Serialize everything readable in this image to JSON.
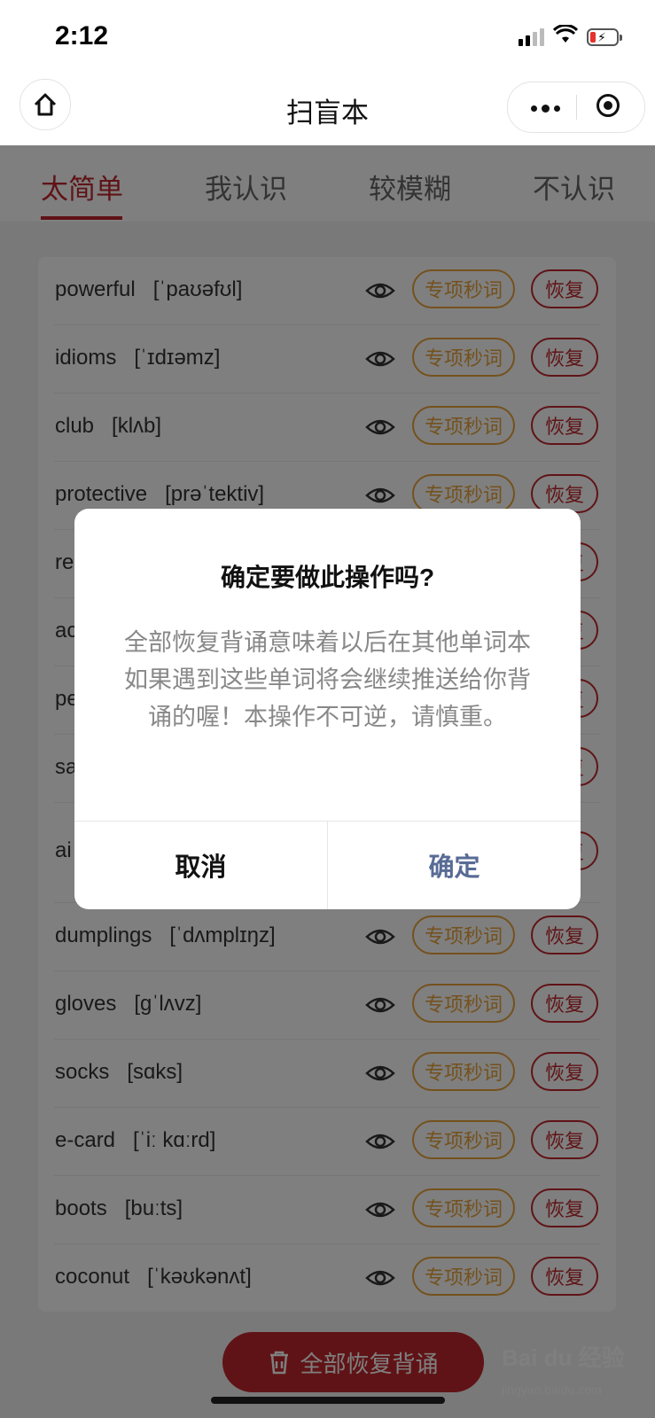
{
  "status_bar": {
    "time": "2:12"
  },
  "nav": {
    "title": "扫盲本"
  },
  "tabs": [
    {
      "label": "太简单",
      "active": true
    },
    {
      "label": "我认识",
      "active": false
    },
    {
      "label": "较模糊",
      "active": false
    },
    {
      "label": "不认识",
      "active": false
    }
  ],
  "words": [
    {
      "word": "powerful",
      "phonetic": "[ˈpaʊəfʊl]"
    },
    {
      "word": "idioms",
      "phonetic": "[ˈɪdɪəmz]"
    },
    {
      "word": "club",
      "phonetic": "[klʌb]"
    },
    {
      "word": "protective",
      "phonetic": "[prəˈtektiv]"
    },
    {
      "word": "re",
      "phonetic": ""
    },
    {
      "word": "ac",
      "phonetic": ""
    },
    {
      "word": "pe",
      "phonetic": ""
    },
    {
      "word": "sa",
      "phonetic": ""
    },
    {
      "word": "ai",
      "phonetic": ""
    },
    {
      "word": "dumplings",
      "phonetic": "[ˈdʌmplɪŋz]"
    },
    {
      "word": "gloves",
      "phonetic": "[gˈlʌvz]"
    },
    {
      "word": "socks",
      "phonetic": "[sɑks]"
    },
    {
      "word": "e-card",
      "phonetic": "[ˈiː kɑːrd]"
    },
    {
      "word": "boots",
      "phonetic": "[buːts]"
    },
    {
      "word": "coconut",
      "phonetic": "[ˈkəʊkənʌt]"
    }
  ],
  "row_buttons": {
    "special": "专项秒词",
    "restore": "恢复"
  },
  "restore_all": "全部恢复背诵",
  "dialog": {
    "title": "确定要做此操作吗?",
    "body": "全部恢复背诵意味着以后在其他单词本如果遇到这些单词将会继续推送给你背诵的喔！本操作不可逆，请慎重。",
    "cancel": "取消",
    "confirm": "确定"
  },
  "watermark": {
    "brand": "Bai du 经验",
    "url": "jingyan.baidu.com"
  },
  "colors": {
    "accent": "#c0272d",
    "orange": "#e8a33a",
    "confirm_blue": "#576b95"
  }
}
